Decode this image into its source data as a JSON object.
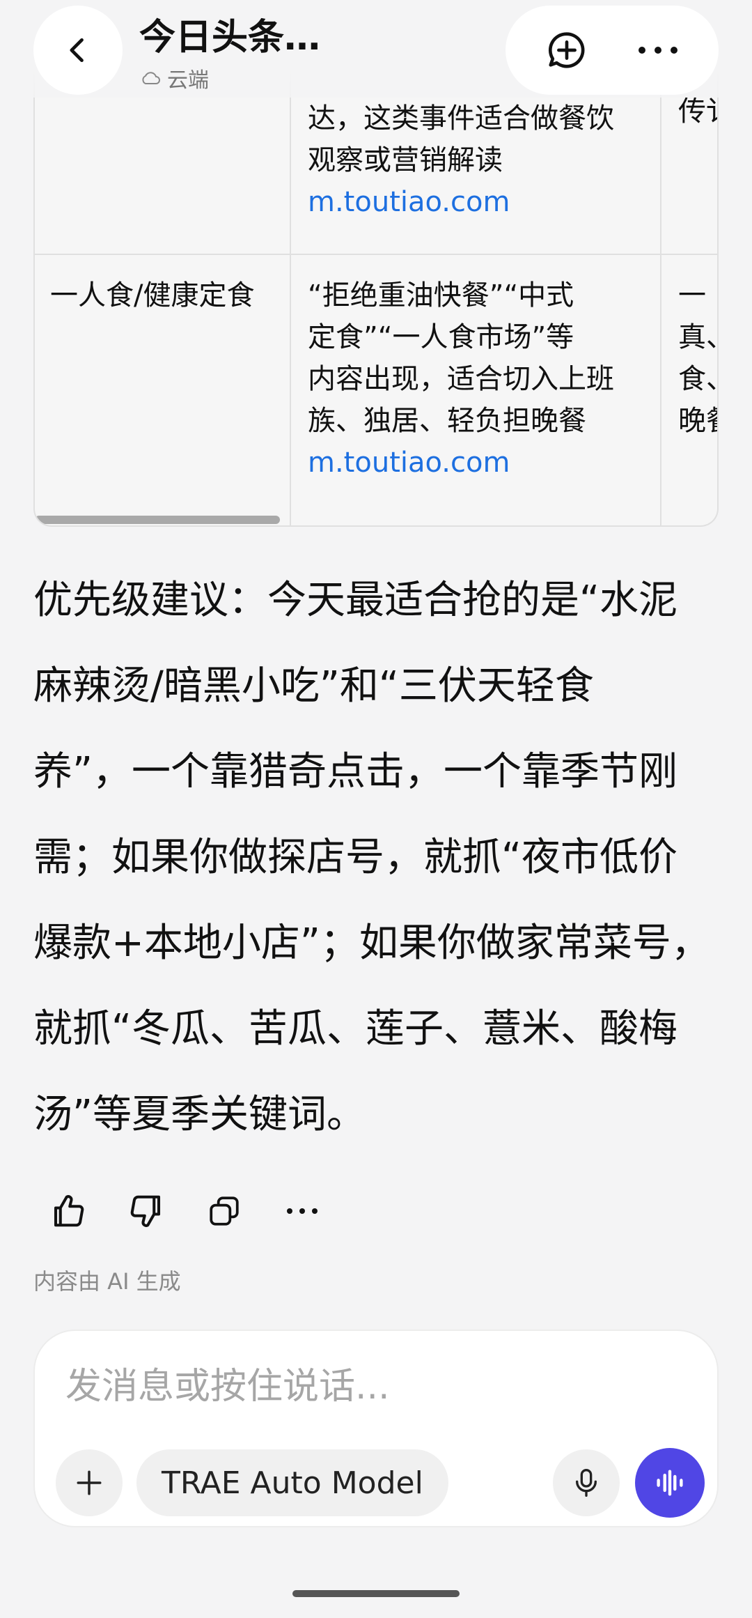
{
  "header": {
    "title": "今日头条…",
    "subtitle": "云端"
  },
  "table": {
    "rows": [
      {
        "col1": "",
        "col2_lines": [
          "达，这类事件适合做餐饮",
          "观察或营销解读"
        ],
        "col2_link": "m.toutiao.com",
        "col3_lines": [
          "传讠"
        ]
      },
      {
        "col1": "一人食/健康定食",
        "col2_lines": [
          "“拒绝重油快餐”“中式",
          "定食”“一人食市场”等",
          "内容出现，适合切入上班",
          "族、独居、轻负担晚餐"
        ],
        "col2_link": "m.toutiao.com",
        "col3_lines": [
          "一",
          "真、",
          "食、",
          "晚餐"
        ]
      }
    ]
  },
  "advice": {
    "lines": [
      "优先级建议：今天最适合抢的是“水泥",
      "麻辣烫/暗黑小吃”和“三伏天轻食",
      "养”，一个靠猎奇点击，一个靠季节刚",
      "需；如果你做探店号，就抓“夜市低价",
      "爆款+本地小店”；如果你做家常菜号，",
      "就抓“冬瓜、苦瓜、莲子、薏米、酸梅",
      "汤”等夏季关键词。"
    ]
  },
  "ai_note": "内容由 AI 生成",
  "composer": {
    "placeholder": "发消息或按住说话...",
    "model_label": "TRAE Auto Model"
  },
  "colors": {
    "accent": "#5046e5",
    "link": "#1d6fe0"
  }
}
